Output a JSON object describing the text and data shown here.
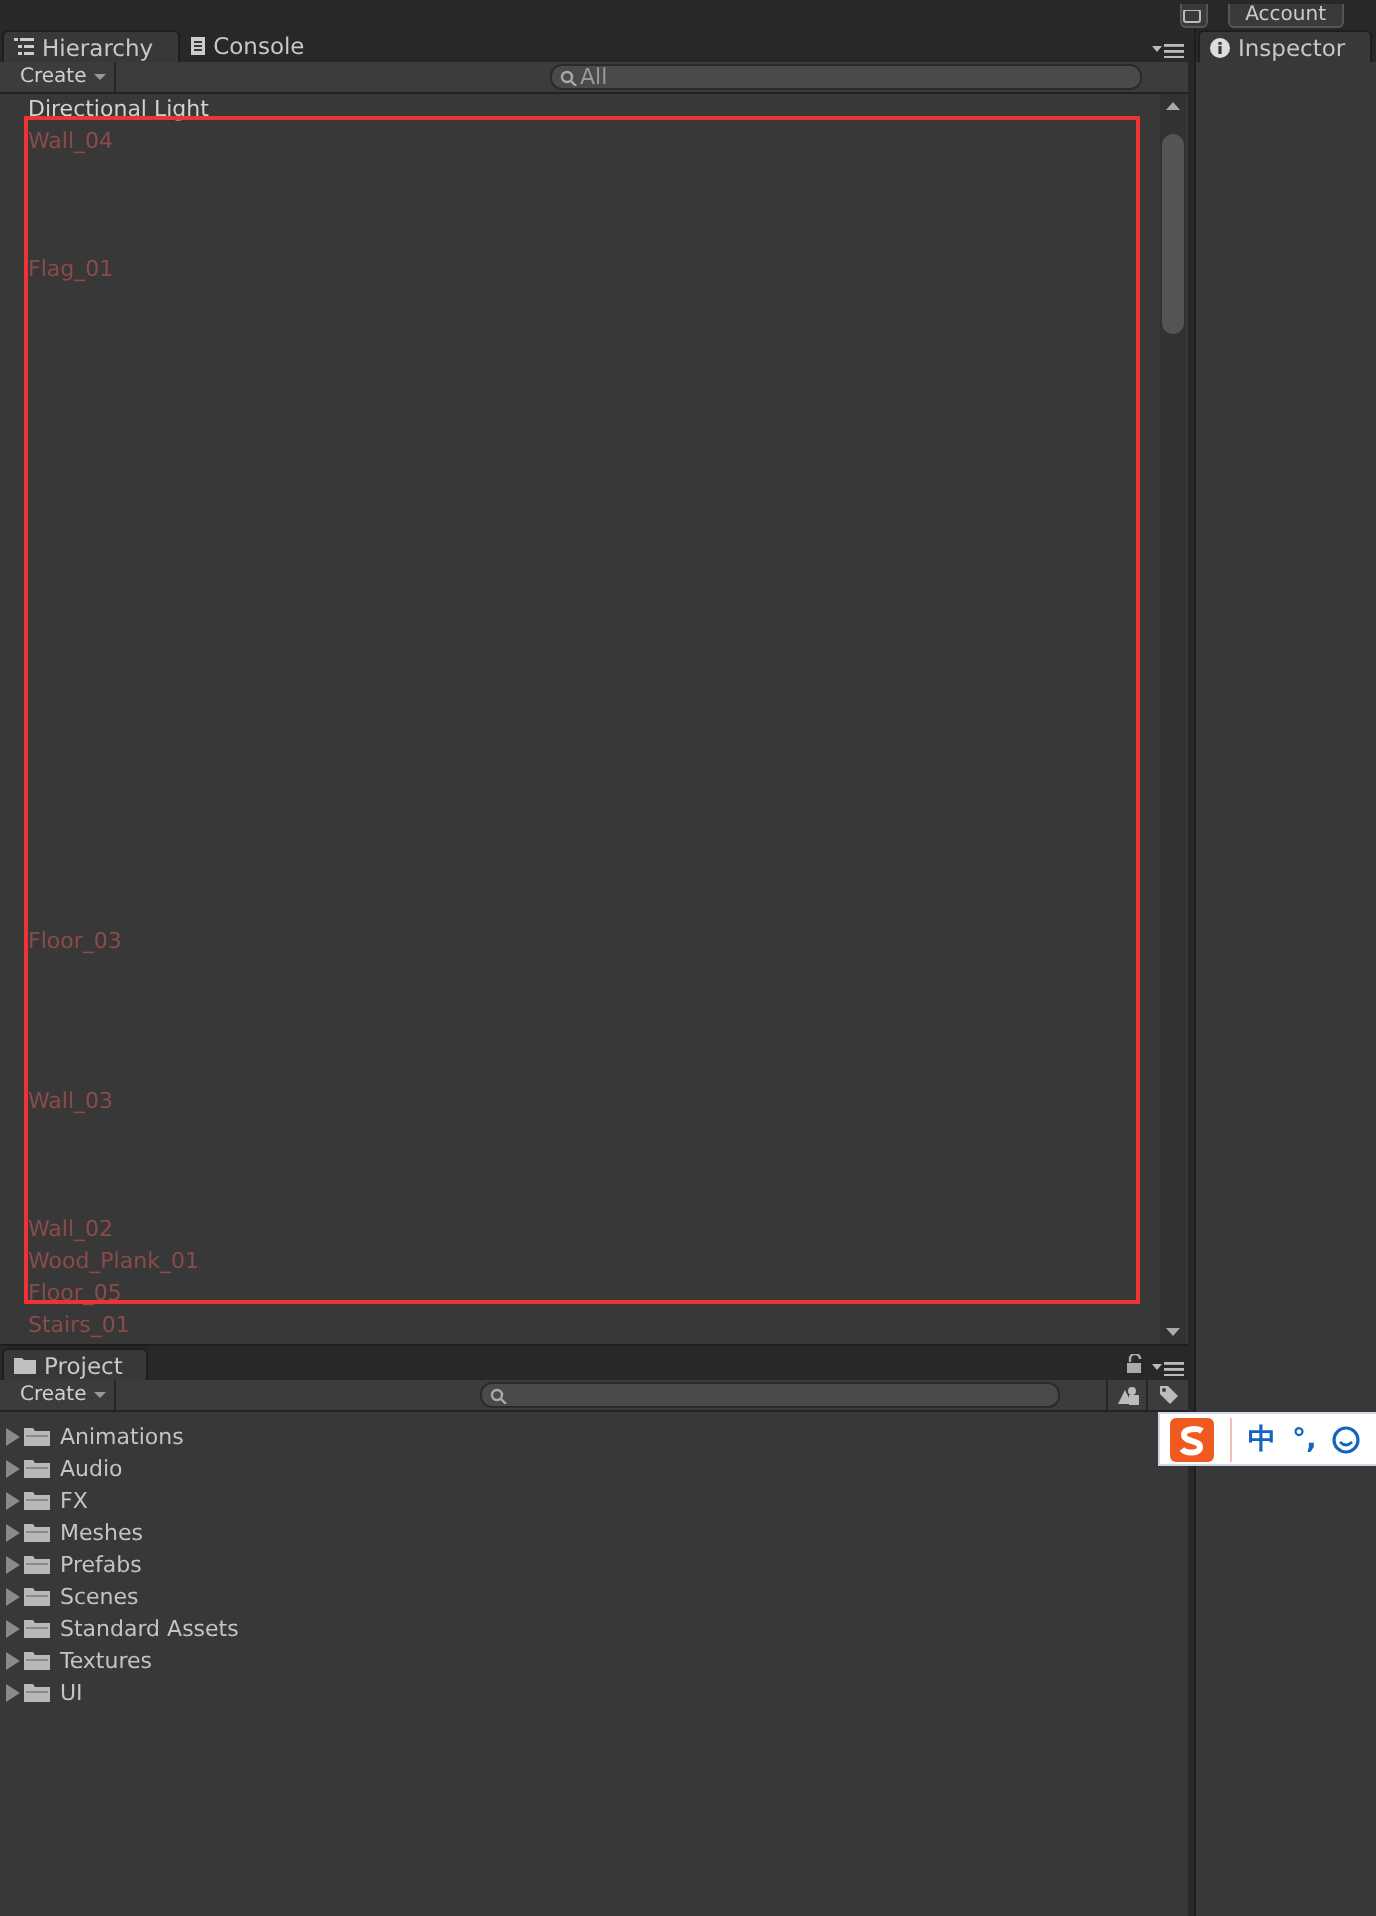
{
  "top_bar": {
    "account_button": "Account"
  },
  "hierarchy_panel": {
    "tabs": [
      {
        "label": "Hierarchy",
        "selected": true,
        "kind": "list"
      },
      {
        "label": "Console",
        "selected": false,
        "kind": "console"
      }
    ],
    "create_button": "Create",
    "search": {
      "placeholder": "All"
    },
    "items": [
      {
        "name": "Directional Light",
        "kind": "object"
      },
      {
        "name": "Wall_04",
        "kind": "missing_prefab"
      },
      {
        "name": "Flag_01",
        "kind": "missing_prefab"
      },
      {
        "name": "Floor_03",
        "kind": "missing_prefab"
      },
      {
        "name": "Wall_03",
        "kind": "missing_prefab"
      },
      {
        "name": "Wall_02",
        "kind": "missing_prefab"
      },
      {
        "name": "Wood_Plank_01",
        "kind": "missing_prefab"
      },
      {
        "name": "Floor_05",
        "kind": "missing_prefab"
      },
      {
        "name": "Stairs_01",
        "kind": "missing_prefab"
      }
    ]
  },
  "project_panel": {
    "tabs": [
      {
        "label": "Project",
        "selected": true,
        "kind": "folder"
      }
    ],
    "create_button": "Create",
    "folders": [
      {
        "name": "Animations",
        "expanded": false
      },
      {
        "name": "Audio",
        "expanded": false
      },
      {
        "name": "FX",
        "expanded": false
      },
      {
        "name": "Meshes",
        "expanded": false
      },
      {
        "name": "Prefabs",
        "expanded": false
      },
      {
        "name": "Scenes",
        "expanded": false
      },
      {
        "name": "Standard Assets",
        "expanded": false
      },
      {
        "name": "Textures",
        "expanded": false
      },
      {
        "name": "UI",
        "expanded": false
      }
    ]
  },
  "inspector_panel": {
    "tabs": [
      {
        "label": "Inspector",
        "selected": true,
        "kind": "info"
      }
    ]
  },
  "ime_toolbar": {
    "items": [
      "中",
      "°,"
    ]
  }
}
